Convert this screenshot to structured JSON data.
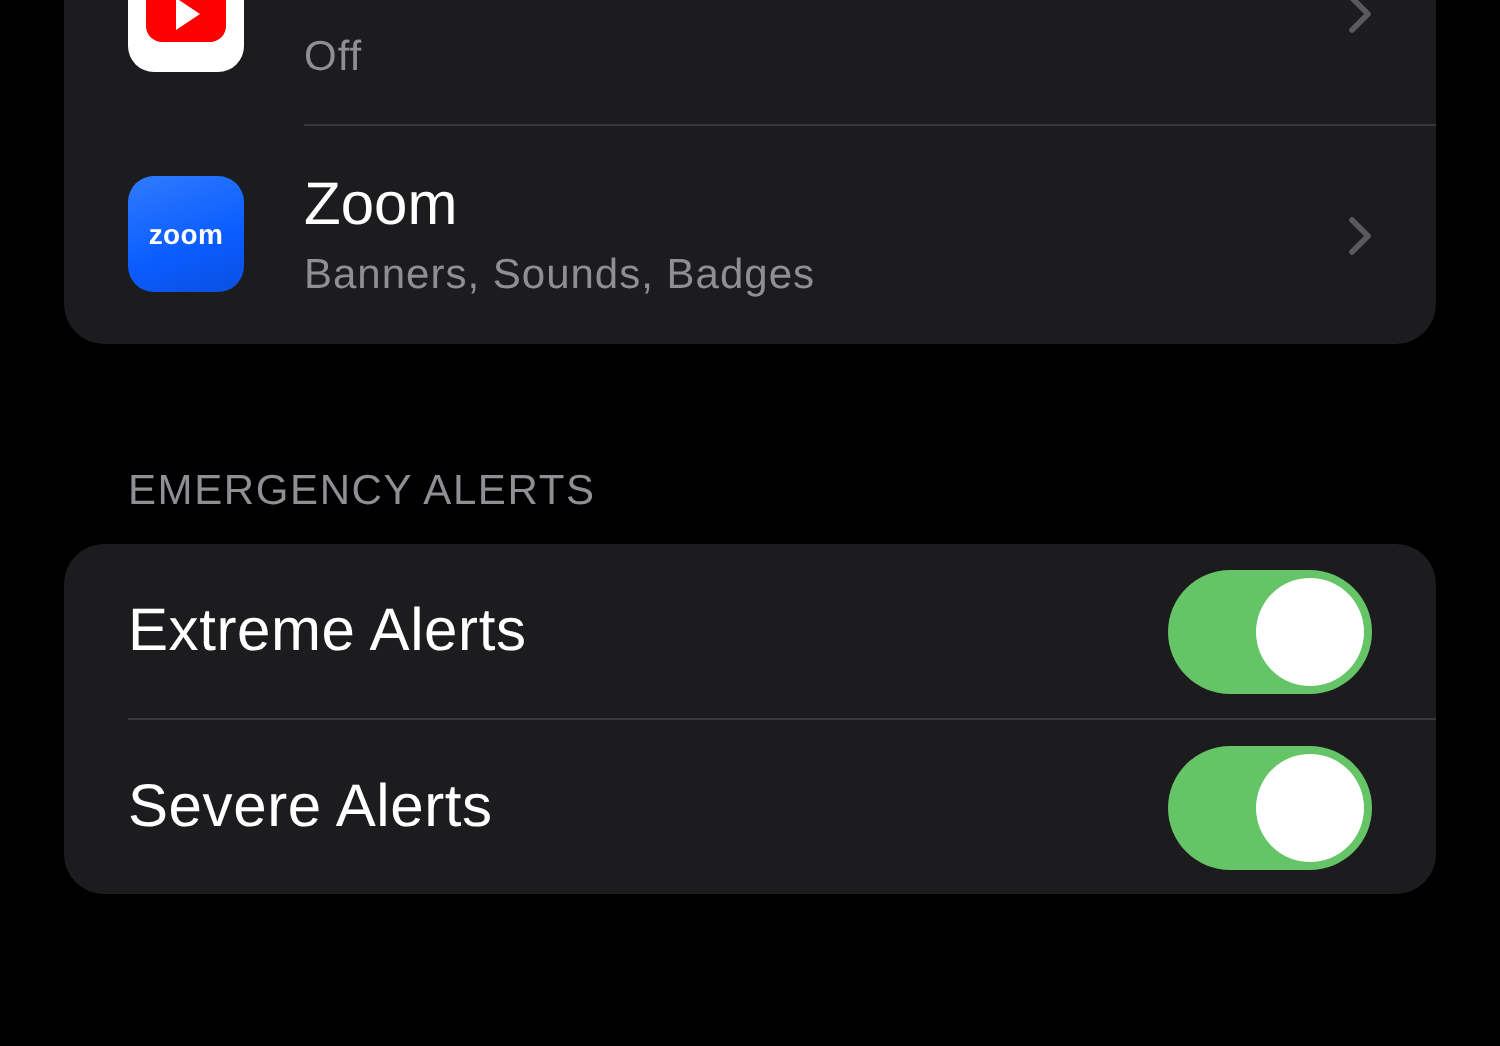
{
  "apps": [
    {
      "kind": "video",
      "subtitle": "Off"
    },
    {
      "kind": "logo",
      "icon_text": "zoom",
      "title": "Zoom",
      "subtitle": "Banners, Sounds, Badges"
    }
  ],
  "emergency": {
    "header": "EMERGENCY ALERTS",
    "items": [
      {
        "label": "Extreme Alerts",
        "on": true
      },
      {
        "label": "Severe Alerts",
        "on": true
      }
    ]
  }
}
